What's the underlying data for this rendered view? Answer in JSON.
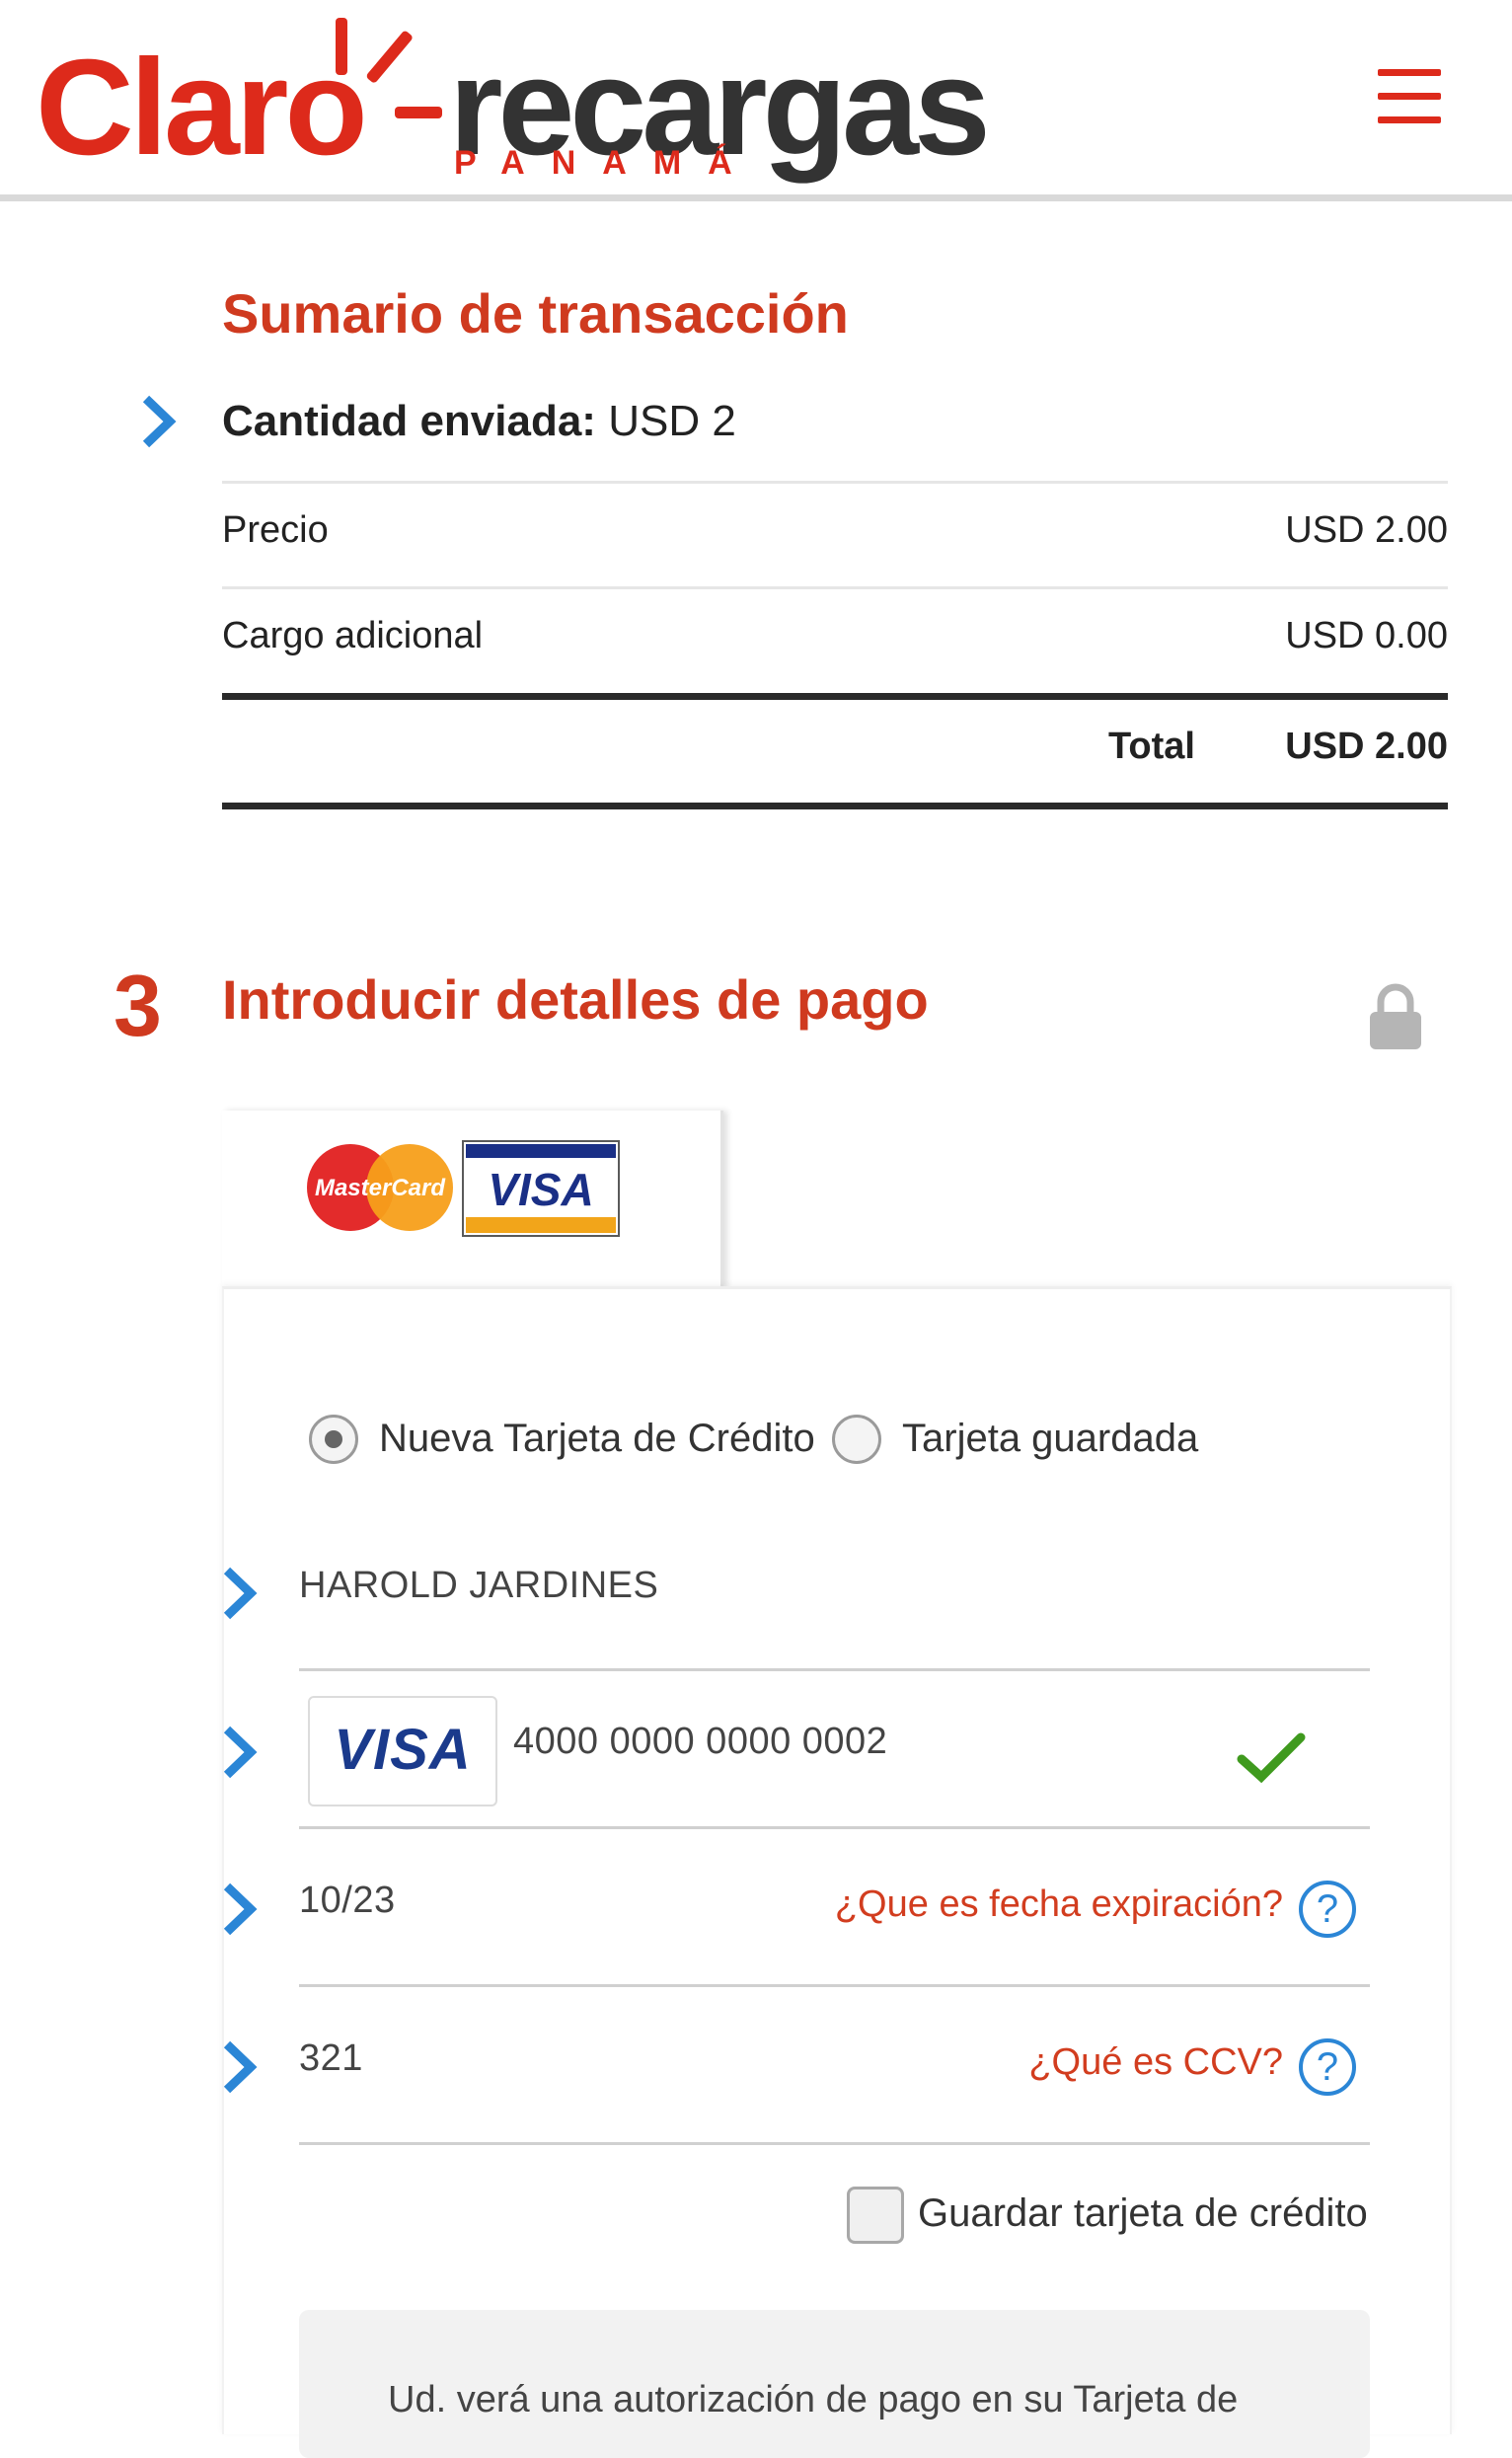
{
  "header": {
    "logo_claro": "Claro",
    "logo_recargas": "recargas",
    "logo_country": "PANAMÁ",
    "menu_icon": "hamburger-menu-icon"
  },
  "summary": {
    "title": "Sumario de transacción",
    "amount_label": "Cantidad enviada:",
    "amount_value": "USD 2",
    "rows": [
      {
        "label": "Precio",
        "value": "USD 2.00"
      },
      {
        "label": "Cargo adicional",
        "value": "USD 0.00"
      }
    ],
    "total_label": "Total",
    "total_value": "USD 2.00"
  },
  "payment": {
    "step_number": "3",
    "title": "Introducir detalles de pago",
    "lock_icon": "lock-icon",
    "card_brands": [
      "MasterCard",
      "VISA"
    ],
    "radio_new_card": "Nueva Tarjeta de Crédito",
    "radio_saved_card": "Tarjeta guardada",
    "selected_option": "Nueva Tarjeta de Crédito",
    "cardholder_name": "HAROLD JARDINES",
    "card_brand_detected": "VISA",
    "card_number": "4000 0000 0000 0002",
    "expiry": "10/23",
    "expiry_help": "¿Que es fecha expiración?",
    "cvv": "321",
    "cvv_help": "¿Qué es CCV?",
    "help_symbol": "?",
    "save_card_label": "Guardar tarjeta de crédito",
    "notice_text": "Ud. verá una autorización de pago en su Tarjeta de"
  },
  "colors": {
    "brand_red": "#dd2a1b",
    "title_red": "#cf3a1f",
    "chevron_blue": "#2b86d6",
    "check_green": "#3f9a1e"
  }
}
